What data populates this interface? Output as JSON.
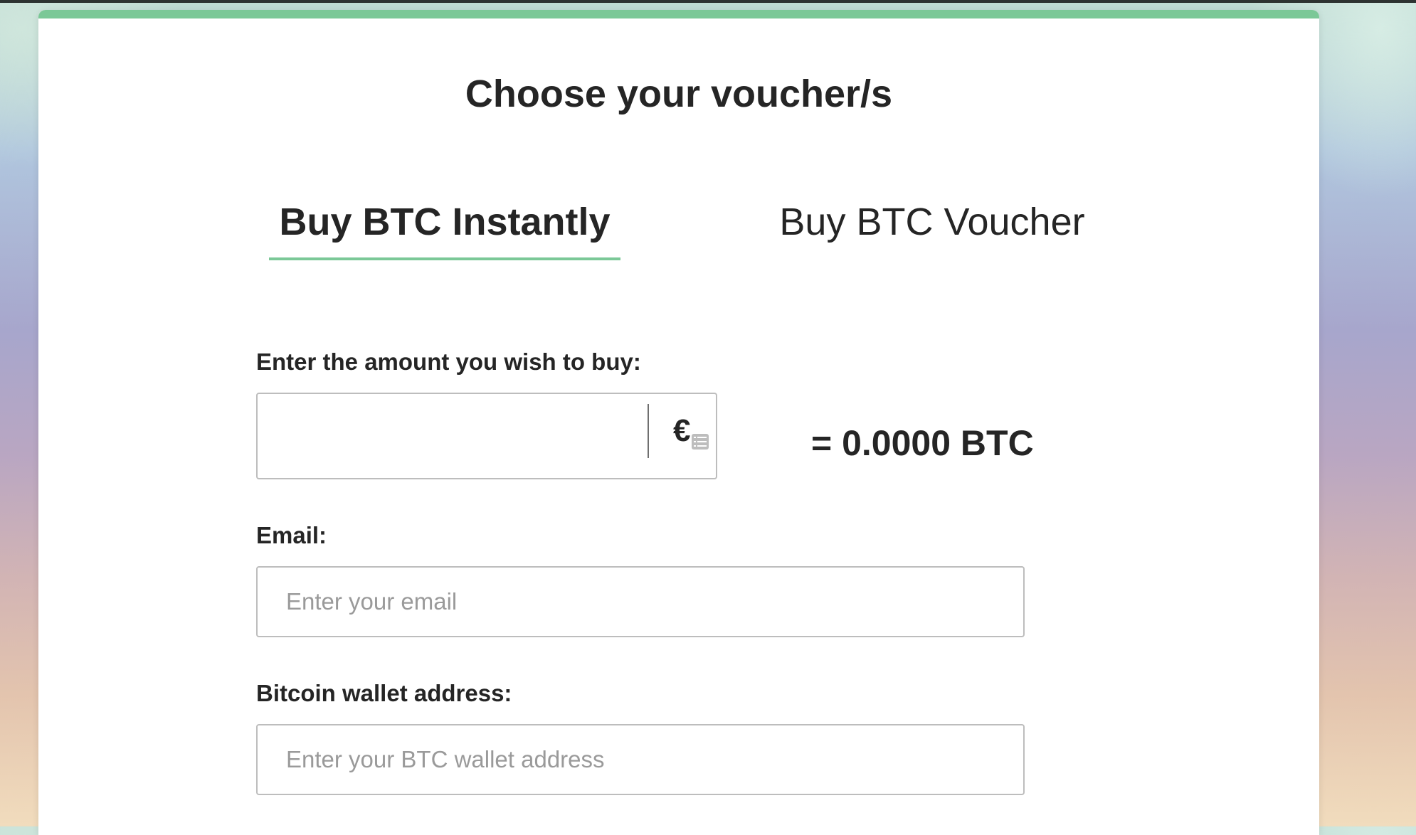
{
  "page": {
    "title": "Choose your voucher/s"
  },
  "tabs": [
    {
      "label": "Buy BTC Instantly",
      "active": true
    },
    {
      "label": "Buy BTC Voucher",
      "active": false
    }
  ],
  "form": {
    "amount_label": "Enter the amount you wish to buy:",
    "amount_value": "",
    "currency_symbol": "€",
    "btc_equivalent": "= 0.0000 BTC",
    "email_label": "Email:",
    "email_placeholder": "Enter your email",
    "wallet_label": "Bitcoin wallet address:",
    "wallet_placeholder": "Enter your BTC wallet address"
  },
  "icons": {
    "currency": "euro-icon",
    "autofill": "list-icon"
  },
  "colors": {
    "accent": "#7bc897",
    "text": "#252525",
    "border": "#bdbdbd",
    "placeholder": "#9a9a9a"
  }
}
